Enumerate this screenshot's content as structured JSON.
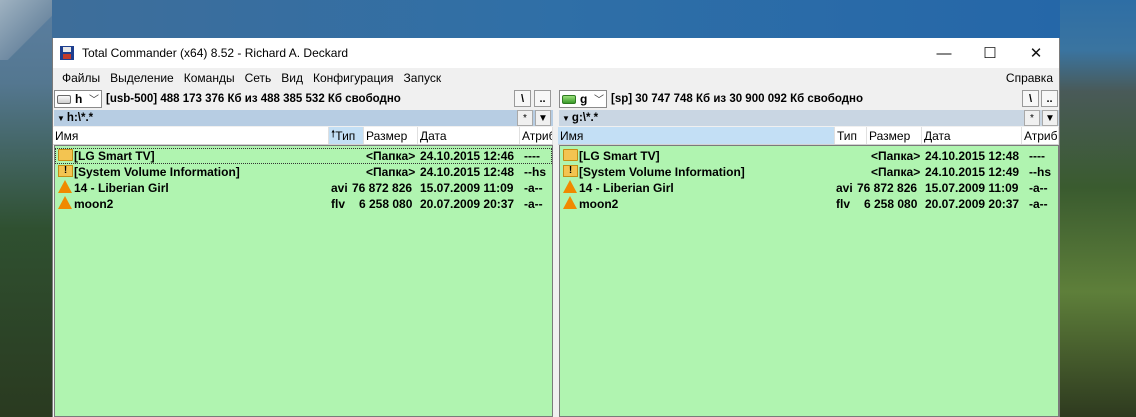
{
  "window": {
    "title": "Total Commander (x64) 8.52 - Richard A. Deckard",
    "minimize": "—",
    "maximize": "☐",
    "close": "✕"
  },
  "menu": {
    "items": [
      "Файлы",
      "Выделение",
      "Команды",
      "Сеть",
      "Вид",
      "Конфигурация",
      "Запуск"
    ],
    "help": "Справка"
  },
  "left_panel": {
    "drive_letter": "h",
    "drive_info": "[usb-500]  488 173 376 Кб из 488 385 532 Кб свободно",
    "path": "h:\\*.*",
    "root_btn": "\\",
    "up_btn": "..",
    "star_btn": "*",
    "dropdown_btn": "▼",
    "headers": {
      "name": "Имя",
      "type": "Тип",
      "size": "Размер",
      "date": "Дата",
      "attr": "Атрибу"
    },
    "sort_arrow": "🠕",
    "files": [
      {
        "name": "[LG Smart TV]",
        "type": "",
        "size": "<Папка>",
        "date": "24.10.2015 12:46",
        "attr": "----",
        "icon": "folder"
      },
      {
        "name": "[System Volume Information]",
        "type": "",
        "size": "<Папка>",
        "date": "24.10.2015 12:48",
        "attr": "--hs",
        "icon": "folder-warning"
      },
      {
        "name": "14 - Liberian Girl",
        "type": "avi",
        "size": "76 872 826",
        "date": "15.07.2009 11:09",
        "attr": "-a--",
        "icon": "vlc-cone"
      },
      {
        "name": "moon2",
        "type": "flv",
        "size": "6 258 080",
        "date": "20.07.2009 20:37",
        "attr": "-a--",
        "icon": "vlc-cone"
      }
    ]
  },
  "right_panel": {
    "drive_letter": "g",
    "drive_info": "[sp]  30 747 748 Кб из 30 900 092 Кб свободно",
    "path": "g:\\*.*",
    "root_btn": "\\",
    "up_btn": "..",
    "star_btn": "*",
    "dropdown_btn": "▼",
    "headers": {
      "name": "Имя",
      "type": "Тип",
      "size": "Размер",
      "date": "Дата",
      "attr": "Атриб"
    },
    "files": [
      {
        "name": "[LG Smart TV]",
        "type": "",
        "size": "<Папка>",
        "date": "24.10.2015 12:48",
        "attr": "----",
        "icon": "folder"
      },
      {
        "name": "[System Volume Information]",
        "type": "",
        "size": "<Папка>",
        "date": "24.10.2015 12:49",
        "attr": "--hs",
        "icon": "folder-warning"
      },
      {
        "name": "14 - Liberian Girl",
        "type": "avi",
        "size": "76 872 826",
        "date": "15.07.2009 11:09",
        "attr": "-a--",
        "icon": "vlc-cone"
      },
      {
        "name": "moon2",
        "type": "flv",
        "size": "6 258 080",
        "date": "20.07.2009 20:37",
        "attr": "-a--",
        "icon": "vlc-cone"
      }
    ]
  }
}
